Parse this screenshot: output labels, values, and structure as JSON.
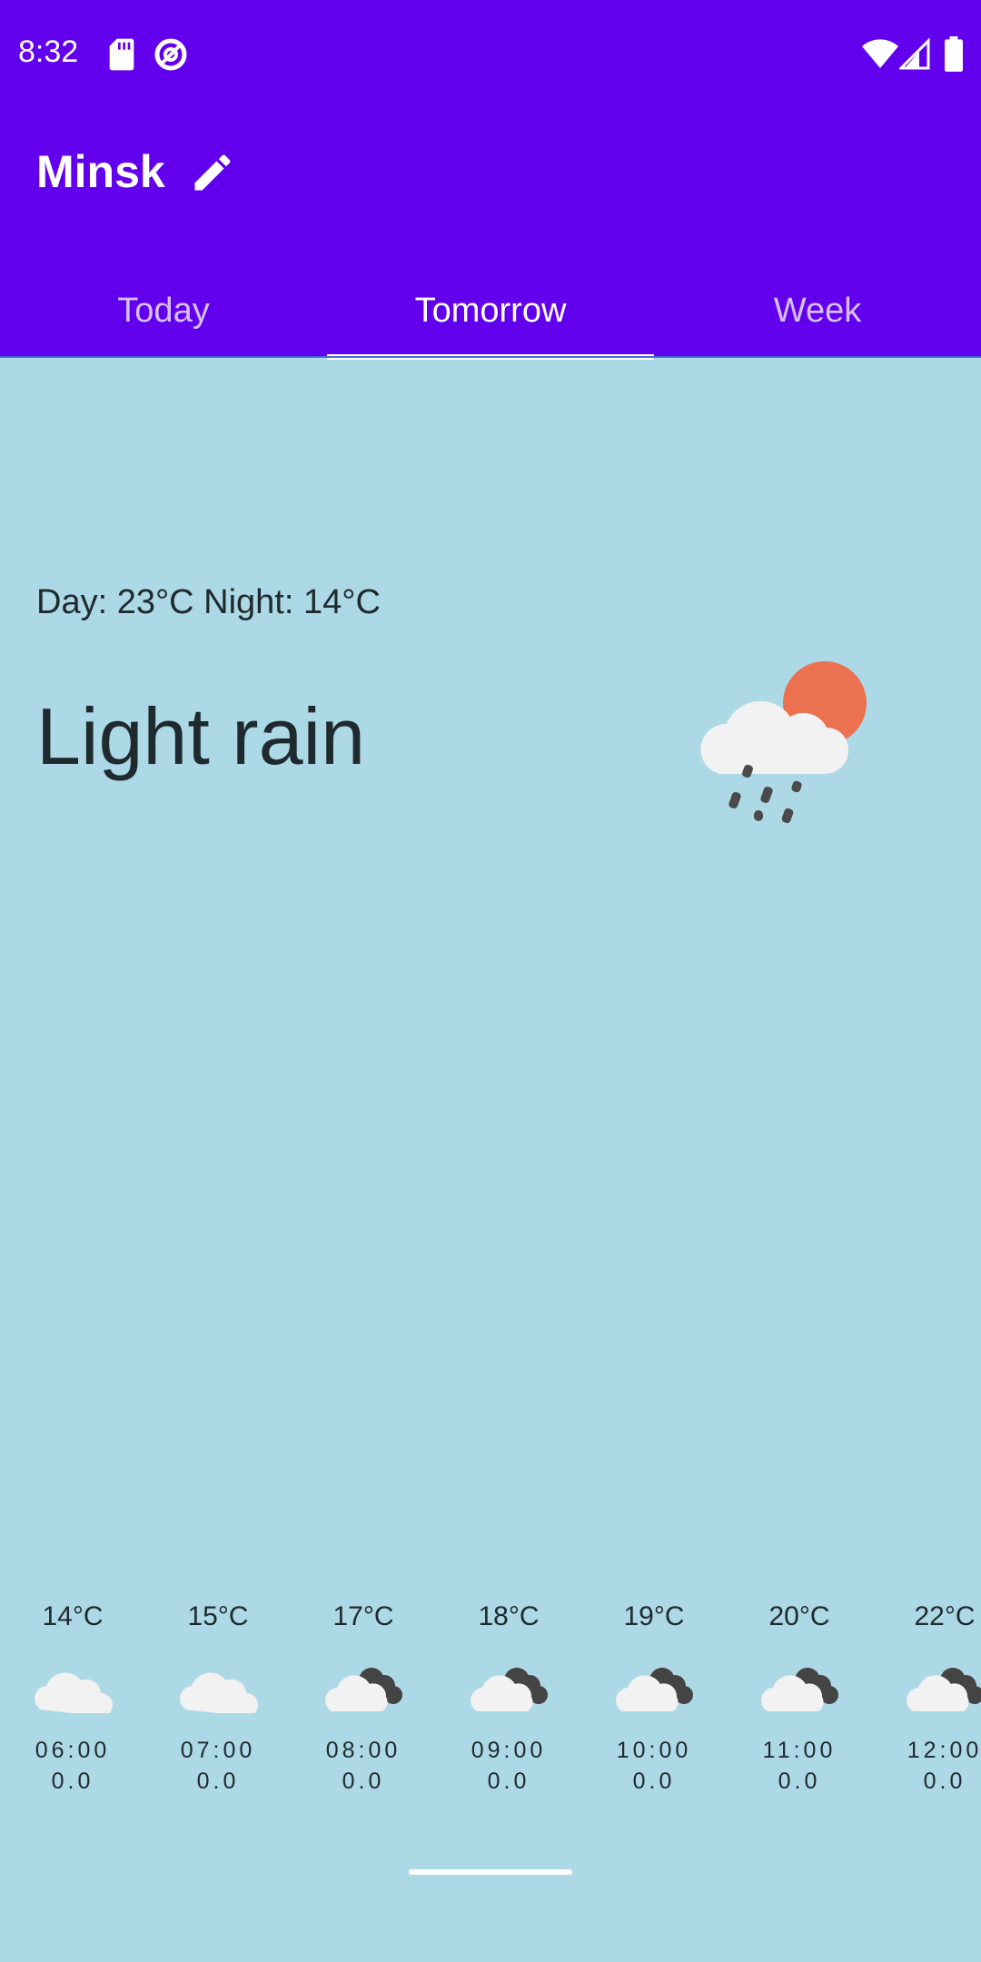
{
  "status_bar": {
    "time": "8:32",
    "left_icons": [
      "sd-card-icon",
      "data-saver-icon"
    ],
    "right_icons": [
      "wifi-icon",
      "signal-icon",
      "battery-icon"
    ]
  },
  "app_bar": {
    "title": "Minsk",
    "edit_icon": "pencil-icon",
    "color": "#6200EE"
  },
  "tabs": {
    "items": [
      {
        "label": "Today",
        "active": false
      },
      {
        "label": "Tomorrow",
        "active": true
      },
      {
        "label": "Week",
        "active": false
      }
    ]
  },
  "forecast": {
    "day_night": "Day: 23°C  Night: 14°C",
    "condition": "Light rain",
    "icon": "light-rain-sun-icon"
  },
  "hourly": [
    {
      "temp": "14°C",
      "time": "06:00",
      "precip": "0.0",
      "icon": "cloud-icon"
    },
    {
      "temp": "15°C",
      "time": "07:00",
      "precip": "0.0",
      "icon": "cloud-icon"
    },
    {
      "temp": "17°C",
      "time": "08:00",
      "precip": "0.0",
      "icon": "cloudy-icon"
    },
    {
      "temp": "18°C",
      "time": "09:00",
      "precip": "0.0",
      "icon": "cloudy-icon"
    },
    {
      "temp": "19°C",
      "time": "10:00",
      "precip": "0.0",
      "icon": "cloudy-icon"
    },
    {
      "temp": "20°C",
      "time": "11:00",
      "precip": "0.0",
      "icon": "cloudy-icon"
    },
    {
      "temp": "22°C",
      "time": "12:00",
      "precip": "0.0",
      "icon": "cloudy-icon"
    }
  ],
  "colors": {
    "background": "#ADD8E6",
    "accent": "#6200EE",
    "sun": "#EC7150",
    "cloud": "#F2F2F2",
    "dark_cloud": "#444444"
  }
}
